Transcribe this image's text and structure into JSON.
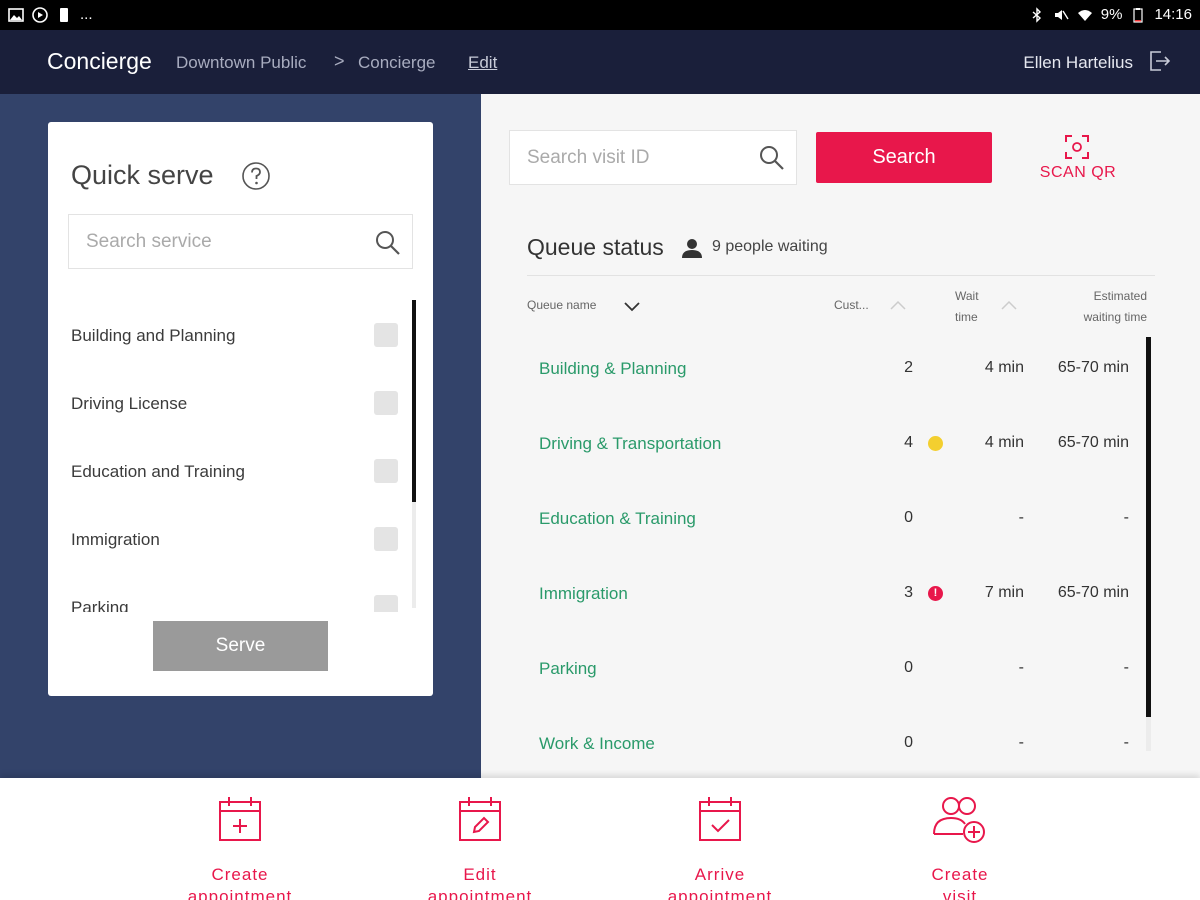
{
  "status_bar": {
    "left_dots": "...",
    "battery": "9%",
    "time": "14:16"
  },
  "header": {
    "app_title": "Concierge",
    "breadcrumb": [
      "Downtown Public",
      "Concierge"
    ],
    "breadcrumb_separator": ">",
    "edit_label": "Edit",
    "user_name": "Ellen Hartelius"
  },
  "quick_serve": {
    "title": "Quick serve",
    "search_placeholder": "Search service",
    "services": [
      {
        "label": "Building and Planning",
        "checked": false
      },
      {
        "label": "Driving License",
        "checked": false
      },
      {
        "label": "Education and Training",
        "checked": false
      },
      {
        "label": "Immigration",
        "checked": false
      },
      {
        "label": "Parking",
        "checked": false
      }
    ],
    "serve_label": "Serve"
  },
  "visit_search": {
    "placeholder": "Search visit ID",
    "search_label": "Search",
    "scan_qr_label": "SCAN QR"
  },
  "queue_status": {
    "title": "Queue status",
    "waiting_text": "9 people waiting",
    "columns": {
      "name": "Queue name",
      "customers": "Cust...",
      "wait_line1": "Wait",
      "wait_line2": "time",
      "est_line1": "Estimated",
      "est_line2": "waiting time"
    },
    "rows": [
      {
        "name": "Building & Planning",
        "customers": "2",
        "wait": "4 min",
        "estimated": "65-70 min",
        "indicator": "none"
      },
      {
        "name": "Driving & Transportation",
        "customers": "4",
        "wait": "4 min",
        "estimated": "65-70 min",
        "indicator": "warning"
      },
      {
        "name": "Education & Training",
        "customers": "0",
        "wait": "-",
        "estimated": "-",
        "indicator": "none"
      },
      {
        "name": "Immigration",
        "customers": "3",
        "wait": "7 min",
        "estimated": "65-70 min",
        "indicator": "alert"
      },
      {
        "name": "Parking",
        "customers": "0",
        "wait": "-",
        "estimated": "-",
        "indicator": "none"
      },
      {
        "name": "Work & Income",
        "customers": "0",
        "wait": "-",
        "estimated": "-",
        "indicator": "none"
      }
    ],
    "alert_glyph": "!"
  },
  "actions": {
    "create_appointment": [
      "Create",
      "appointment"
    ],
    "edit_appointment": [
      "Edit",
      "appointment"
    ],
    "arrive_appointment": [
      "Arrive",
      "appointment"
    ],
    "create_visit": [
      "Create",
      "visit"
    ]
  },
  "colors": {
    "header_bg": "#1a1f3a",
    "left_panel_bg": "#33436a",
    "accent": "#e8174b",
    "queue_link": "#2a9a6a",
    "warning": "#f3cf2f"
  }
}
